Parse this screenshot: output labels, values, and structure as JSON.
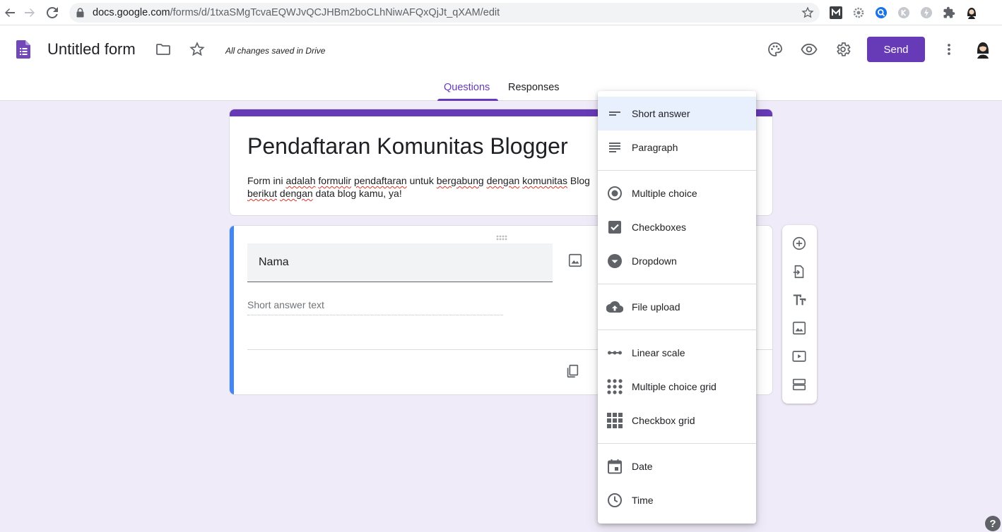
{
  "browser": {
    "url_host": "docs.google.com",
    "url_path": "/forms/d/1txaSMgTcvaEQWJvQCJHBm2boCLhNiwAFQxQjJt_qXAM/edit"
  },
  "header": {
    "doc_title": "Untitled form",
    "save_status": "All changes saved in Drive",
    "send_label": "Send",
    "accent_color": "#673ab7"
  },
  "tabs": [
    {
      "label": "Questions",
      "active": true
    },
    {
      "label": "Responses",
      "active": false
    }
  ],
  "form": {
    "title": "Pendaftaran Komunitas Blogger",
    "description_line1_parts": [
      "Form ini ",
      "adalah",
      " ",
      "formulir",
      " ",
      "pendaftaran",
      " untuk ",
      "bergabung",
      " ",
      "dengan",
      " ",
      "komunitas",
      " Blog"
    ],
    "description_line2_parts": [
      "berikut",
      " ",
      "dengan",
      " data blog kamu, ya!"
    ]
  },
  "question": {
    "title": "Nama",
    "answer_hint": "Short answer text"
  },
  "menu": {
    "groups": [
      [
        {
          "label": "Short answer",
          "icon": "short-answer-icon",
          "selected": true
        },
        {
          "label": "Paragraph",
          "icon": "paragraph-icon"
        }
      ],
      [
        {
          "label": "Multiple choice",
          "icon": "radio-icon"
        },
        {
          "label": "Checkboxes",
          "icon": "checkbox-icon"
        },
        {
          "label": "Dropdown",
          "icon": "dropdown-icon"
        }
      ],
      [
        {
          "label": "File upload",
          "icon": "cloud-upload-icon"
        }
      ],
      [
        {
          "label": "Linear scale",
          "icon": "linear-scale-icon"
        },
        {
          "label": "Multiple choice grid",
          "icon": "dot-grid-icon"
        },
        {
          "label": "Checkbox grid",
          "icon": "square-grid-icon"
        }
      ],
      [
        {
          "label": "Date",
          "icon": "calendar-icon"
        },
        {
          "label": "Time",
          "icon": "clock-icon"
        }
      ]
    ]
  },
  "help": {
    "label": "?"
  }
}
